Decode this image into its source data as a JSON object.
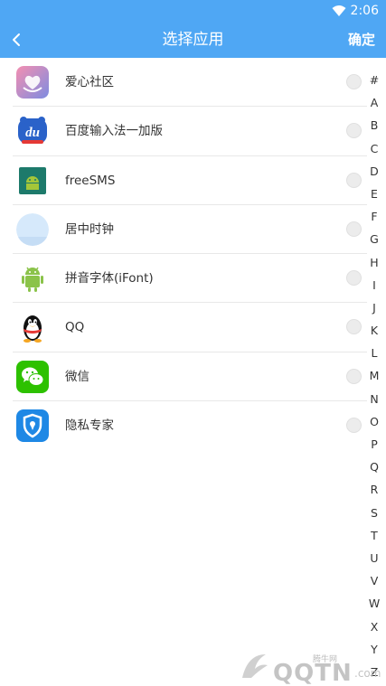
{
  "status_bar": {
    "time": "2:06",
    "wifi_icon": "wifi-icon"
  },
  "toolbar": {
    "title": "选择应用",
    "confirm_label": "确定",
    "back_icon": "chevron-left-icon"
  },
  "apps": [
    {
      "name": "爱心社区",
      "icon": "aixin-community-icon",
      "selected": false
    },
    {
      "name": "百度输入法一加版",
      "icon": "baidu-input-icon",
      "selected": false
    },
    {
      "name": "freeSMS",
      "icon": "android-robot-icon",
      "selected": false
    },
    {
      "name": "居中时钟",
      "icon": "clock-circle-icon",
      "selected": false
    },
    {
      "name": "拼音字体(iFont)",
      "icon": "android-robot-icon",
      "selected": false
    },
    {
      "name": "QQ",
      "icon": "qq-penguin-icon",
      "selected": false
    },
    {
      "name": "微信",
      "icon": "wechat-icon",
      "selected": false
    },
    {
      "name": "隐私专家",
      "icon": "privacy-shield-icon",
      "selected": false
    }
  ],
  "index_letters": [
    "#",
    "A",
    "B",
    "C",
    "D",
    "E",
    "F",
    "G",
    "H",
    "I",
    "J",
    "K",
    "L",
    "M",
    "N",
    "O",
    "P",
    "Q",
    "R",
    "S",
    "T",
    "U",
    "V",
    "W",
    "X",
    "Y",
    "Z"
  ],
  "colors": {
    "accent": "#4fa7f4",
    "text": "#333333",
    "divider": "#e8e8e8"
  },
  "watermark": {
    "cn": "腾牛网",
    "text": "QQTN",
    "suffix": ".com"
  }
}
